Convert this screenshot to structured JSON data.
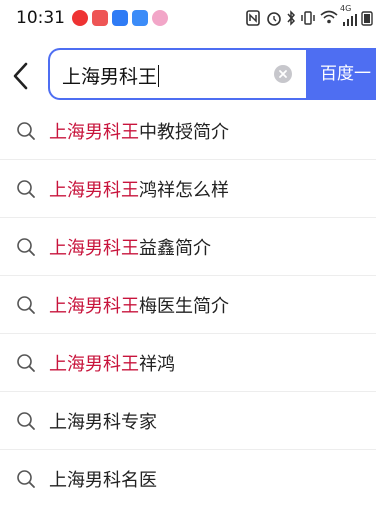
{
  "status_bar": {
    "time": "10:31",
    "network": "4G",
    "icons": [
      "notification-red-icon",
      "notification-red-icon",
      "app-blue-icon",
      "app-blue-icon",
      "app-pink-icon",
      "nfc-icon",
      "alarm-icon",
      "bluetooth-icon",
      "vibrate-icon",
      "wifi-icon",
      "signal-icon",
      "battery-icon"
    ]
  },
  "search": {
    "query": "上海男科王",
    "button_label": "百度一"
  },
  "suggestions": [
    {
      "highlight": "上海男科王",
      "rest": "中教授简介"
    },
    {
      "highlight": "上海男科王",
      "rest": "鸿祥怎么样"
    },
    {
      "highlight": "上海男科王",
      "rest": "益鑫简介"
    },
    {
      "highlight": "上海男科王",
      "rest": "梅医生简介"
    },
    {
      "highlight": "上海男科王",
      "rest": "祥鸿"
    },
    {
      "highlight": "",
      "rest": "上海男科专家"
    },
    {
      "highlight": "",
      "rest": "上海男科名医"
    }
  ],
  "colors": {
    "accent": "#4e6ef2",
    "highlight": "#c8143c"
  }
}
